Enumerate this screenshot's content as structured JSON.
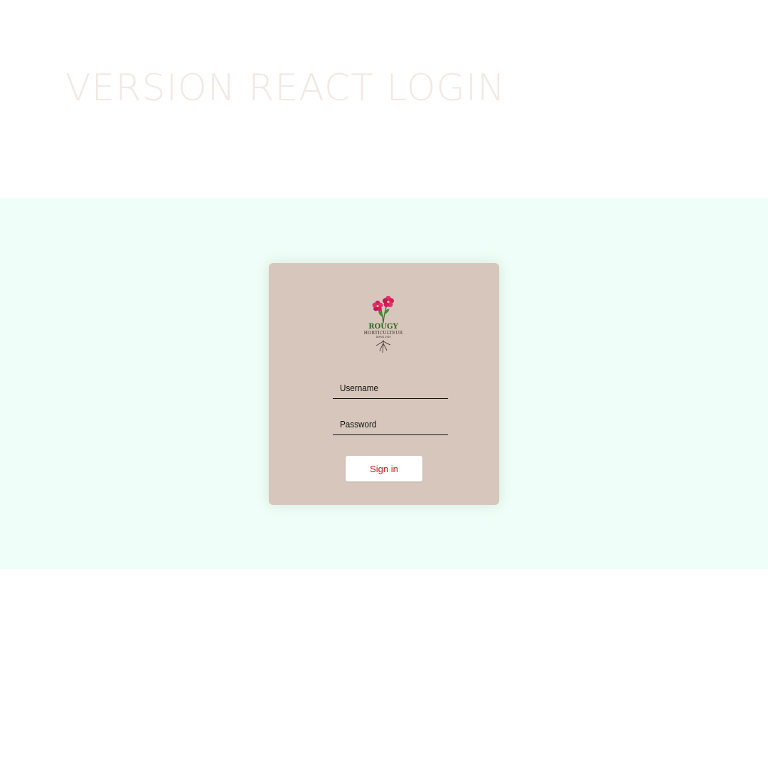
{
  "header": {
    "title": "VERSION REACT LOGIN"
  },
  "login": {
    "logo": {
      "icon": "flower-logo-icon",
      "brand": "ROUGY",
      "subtitle": "HORTICULTEUR",
      "tagline": "DEPUIS 1919"
    },
    "username": {
      "placeholder": "Username",
      "value": ""
    },
    "password": {
      "placeholder": "Password",
      "value": ""
    },
    "submit_label": "Sign in"
  },
  "colors": {
    "title": "#f3e8e3",
    "band_background": "#effef8",
    "card_background": "#d6c6bb",
    "button_text": "#cc1a1a",
    "logo_flower": "#d81b60",
    "logo_brand": "#2e6b1f"
  }
}
